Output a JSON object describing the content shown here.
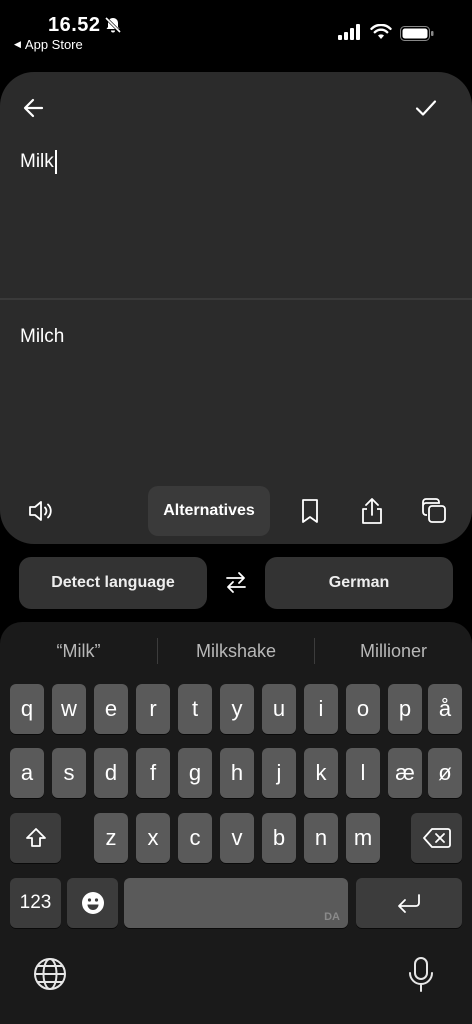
{
  "status_bar": {
    "time": "16.52",
    "back_app": "App Store",
    "icons": [
      "bell-slash-icon",
      "cellular-signal-icon",
      "wifi-icon",
      "battery-icon"
    ]
  },
  "editor": {
    "back_icon": "arrow-left-icon",
    "confirm_icon": "checkmark-icon",
    "source_text": "Milk",
    "translated_text": "Milch"
  },
  "toolbar": {
    "speaker_icon": "speaker-icon",
    "alternatives_label": "Alternatives",
    "bookmark_icon": "bookmark-icon",
    "share_icon": "share-icon",
    "copy_icon": "copy-icon"
  },
  "languages": {
    "source": "Detect language",
    "target": "German",
    "swap_icon": "swap-arrows-icon"
  },
  "keyboard": {
    "suggestions": [
      "“Milk”",
      "Milkshake",
      "Millioner"
    ],
    "row1": [
      "q",
      "w",
      "e",
      "r",
      "t",
      "y",
      "u",
      "i",
      "o",
      "p",
      "å"
    ],
    "row2": [
      "a",
      "s",
      "d",
      "f",
      "g",
      "h",
      "j",
      "k",
      "l",
      "æ",
      "ø"
    ],
    "row3": [
      "z",
      "x",
      "c",
      "v",
      "b",
      "n",
      "m"
    ],
    "numbers_label": "123",
    "space_language": "DA",
    "colors": {
      "key": "#5a5a5a",
      "special_key": "#3c3c3c",
      "background": "#1a1a1a",
      "card": "#2b2b2b"
    }
  }
}
